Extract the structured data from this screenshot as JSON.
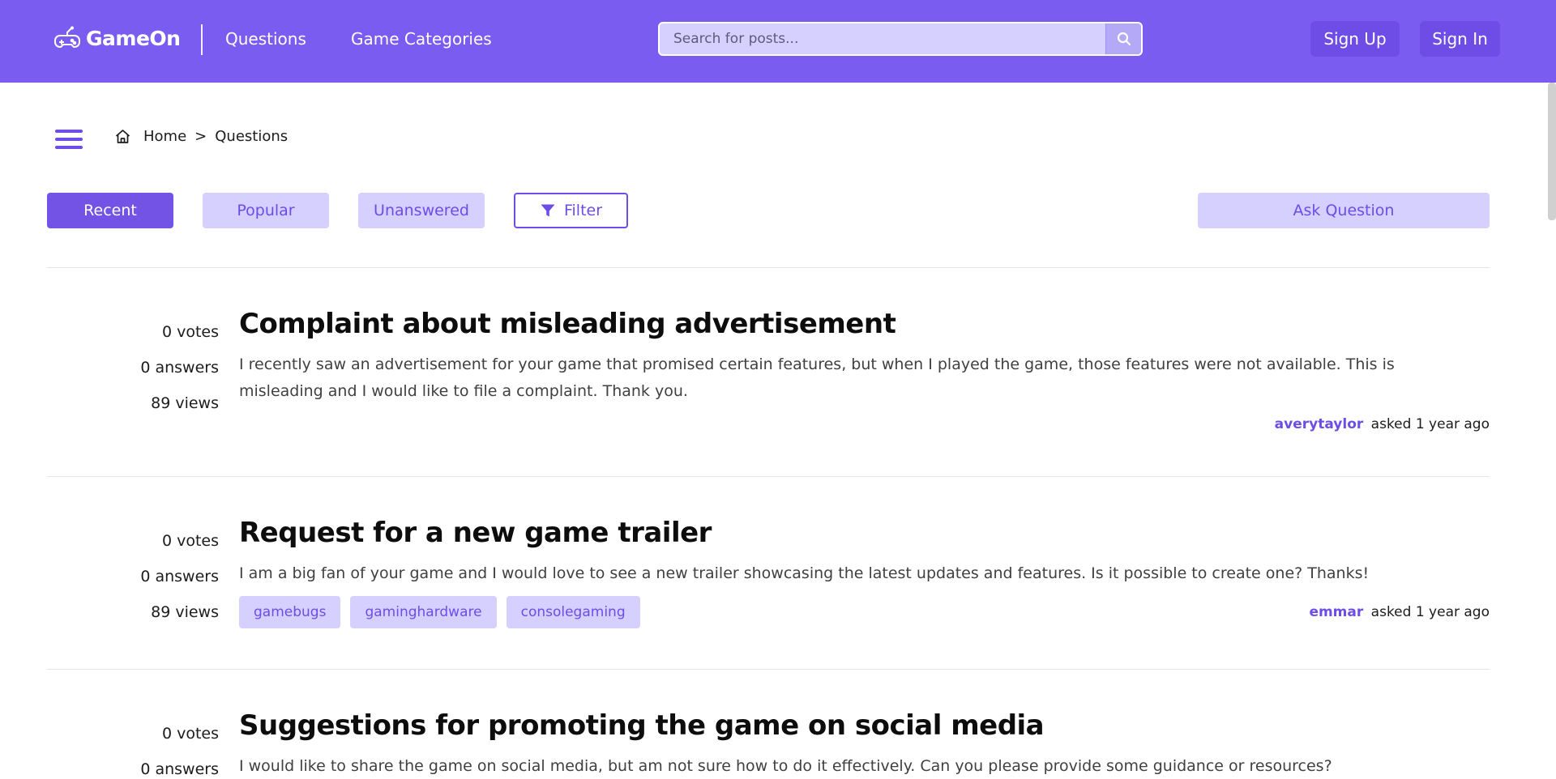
{
  "header": {
    "brand": "GameOn",
    "nav": [
      "Questions",
      "Game Categories"
    ],
    "search_placeholder": "Search for posts...",
    "sign_up": "Sign Up",
    "sign_in": "Sign In"
  },
  "breadcrumb": {
    "home": "Home",
    "separator": ">",
    "current": "Questions"
  },
  "tabs": {
    "recent": "Recent",
    "popular": "Popular",
    "unanswered": "Unanswered",
    "filter": "Filter",
    "ask": "Ask Question"
  },
  "questions": [
    {
      "votes": "0 votes",
      "answers": "0 answers",
      "views": "89 views",
      "title": "Complaint about misleading advertisement",
      "body": "I recently saw an advertisement for your game that promised certain features, but when I played the game, those features were not available. This is misleading and I would like to file a complaint. Thank you.",
      "user": "averytaylor",
      "asked": "asked 1 year ago",
      "tags": []
    },
    {
      "votes": "0 votes",
      "answers": "0 answers",
      "views": "89 views",
      "title": "Request for a new game trailer",
      "body": "I am a big fan of your game and I would love to see a new trailer showcasing the latest updates and features. Is it possible to create one? Thanks!",
      "user": "emmar",
      "asked": "asked 1 year ago",
      "tags": [
        "gamebugs",
        "gaminghardware",
        "consolegaming"
      ]
    },
    {
      "votes": "0 votes",
      "answers": "0 answers",
      "title": "Suggestions for promoting the game on social media",
      "body": "I would like to share the game on social media, but am not sure how to do it effectively. Can you please provide some guidance or resources?"
    }
  ],
  "colors": {
    "primary": "#7b5cf0",
    "primary_dark": "#6d4de6",
    "tint": "#d5d0ff"
  }
}
